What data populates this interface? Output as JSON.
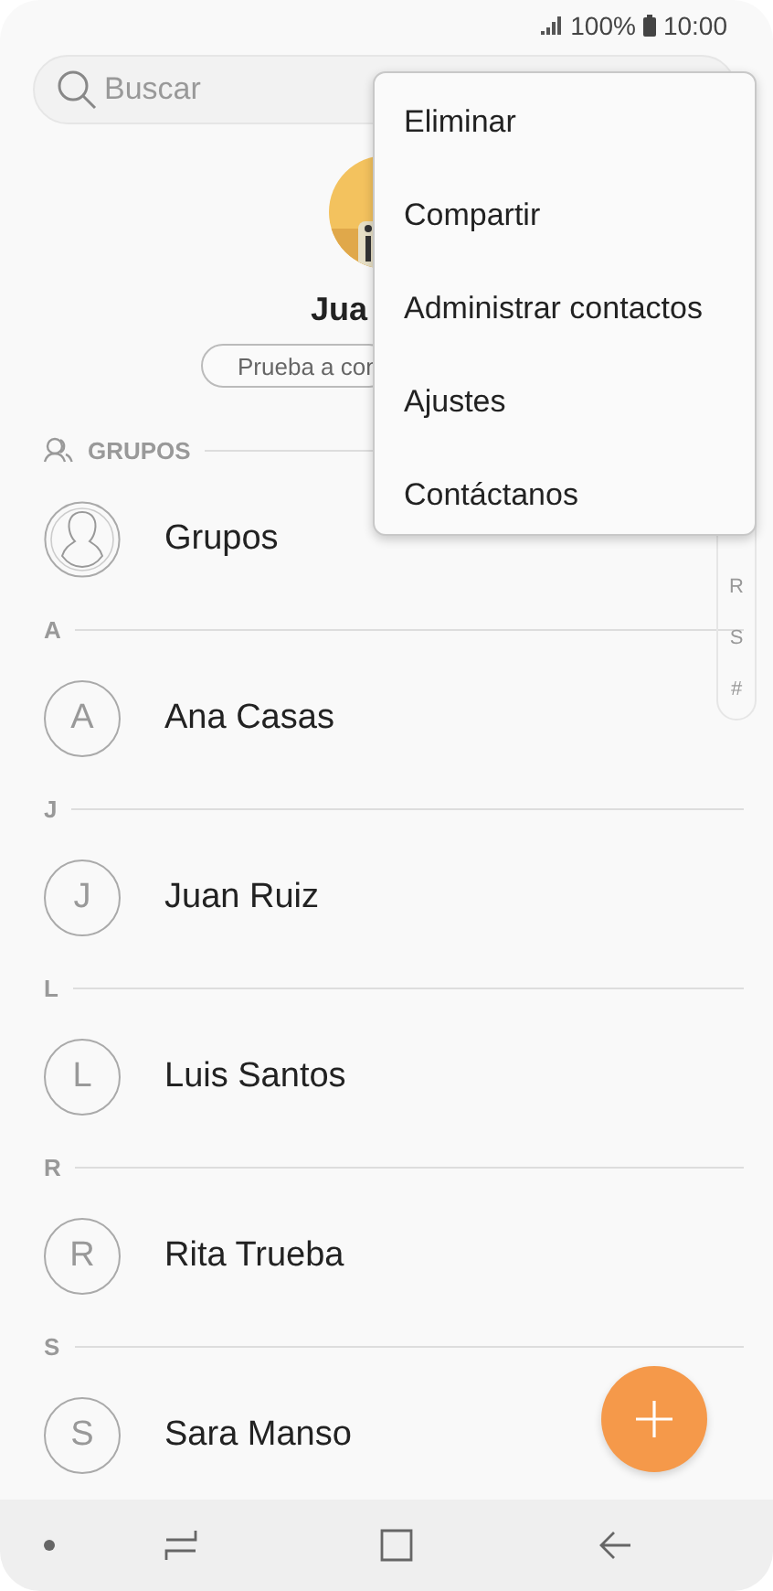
{
  "status_bar": {
    "battery": "100%",
    "time": "10:00"
  },
  "search": {
    "placeholder": "Buscar"
  },
  "profile": {
    "kind": "picture",
    "name": "Jua",
    "button": "Prueba a con"
  },
  "groups": {
    "header": "GRUPOS",
    "label": "Grupos"
  },
  "sections": [
    {
      "letter": "A",
      "contacts": [
        {
          "initial": "A",
          "name": "Ana Casas"
        }
      ]
    },
    {
      "letter": "J",
      "contacts": [
        {
          "initial": "J",
          "name": "Juan Ruiz"
        }
      ]
    },
    {
      "letter": "L",
      "contacts": [
        {
          "initial": "L",
          "name": "Luis Santos"
        }
      ]
    },
    {
      "letter": "R",
      "contacts": [
        {
          "initial": "R",
          "name": "Rita Trueba"
        }
      ]
    },
    {
      "letter": "S",
      "contacts": [
        {
          "initial": "S",
          "name": "Sara Manso"
        }
      ]
    }
  ],
  "index_letters": [
    "R",
    "S",
    "#"
  ],
  "menu": [
    "Eliminar",
    "Compartir",
    "Administrar contactos",
    "Ajustes",
    "Contáctanos"
  ]
}
